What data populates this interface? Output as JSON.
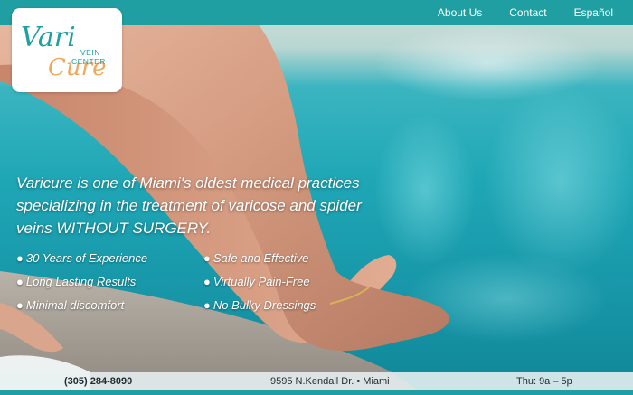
{
  "nav": {
    "links": [
      {
        "label": "About Us"
      },
      {
        "label": "Contact"
      },
      {
        "label": "Español"
      }
    ]
  },
  "logo": {
    "text_vari": "Vari",
    "text_cure": "Cure",
    "text_vein": "VEIN",
    "text_center": "CENTER",
    "colors": {
      "teal": "#1f9fa1",
      "orange": "#f0a85c"
    }
  },
  "hero": {
    "headline": "Varicure is one of Miami's oldest medical practices specializing in the treatment of varicose and spider veins WITHOUT SURGERY.",
    "bullet_glyph": "●",
    "features": [
      "30 Years of Experience",
      "Safe and Effective",
      "Long Lasting Results",
      "Virtually Pain-Free",
      "Minimal discomfort",
      "No Bulky Dressings"
    ]
  },
  "footer": {
    "phone": "(305) 284-8090",
    "address": "9595 N.Kendall Dr. • Miami",
    "hours": "Thu: 9a – 5p"
  },
  "colors": {
    "brand_teal": "#1f9fa1",
    "pool": "#1fa7b6",
    "text_light": "#ffffff"
  }
}
